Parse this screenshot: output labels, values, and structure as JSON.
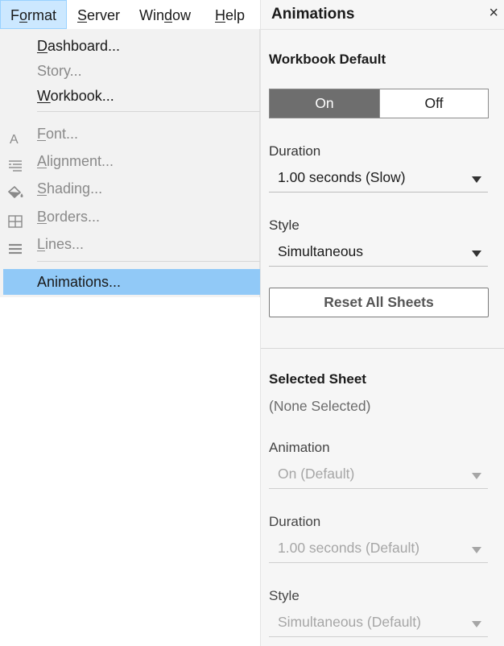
{
  "menubar": {
    "items": [
      {
        "pre": "F",
        "u": "o",
        "post": "rmat"
      },
      {
        "pre": "",
        "u": "S",
        "post": "erver"
      },
      {
        "pre": "Win",
        "u": "d",
        "post": "ow"
      },
      {
        "pre": "",
        "u": "H",
        "post": "elp"
      }
    ]
  },
  "format_menu": {
    "dashboard": {
      "u": "D",
      "post": "ashboard..."
    },
    "story": {
      "label": "Story..."
    },
    "workbook": {
      "u": "W",
      "post": "orkbook..."
    },
    "font": {
      "u": "F",
      "post": "ont...",
      "icon": "font-icon"
    },
    "alignment": {
      "u": "A",
      "post": "lignment...",
      "icon": "alignment-icon"
    },
    "shading": {
      "u": "S",
      "post": "hading...",
      "icon": "paint-bucket-icon"
    },
    "borders": {
      "u": "B",
      "post": "orders...",
      "icon": "borders-icon"
    },
    "lines": {
      "u": "L",
      "post": "ines...",
      "icon": "lines-icon"
    },
    "animations": {
      "label": "Animations..."
    }
  },
  "panel": {
    "title": "Animations",
    "close_glyph": "×",
    "workbook_default": {
      "title": "Workbook Default",
      "toggle": {
        "on": "On",
        "off": "Off",
        "selected": "On"
      },
      "duration_label": "Duration",
      "duration_value": "1.00 seconds (Slow)",
      "style_label": "Style",
      "style_value": "Simultaneous",
      "reset_label": "Reset All Sheets"
    },
    "selected_sheet": {
      "title": "Selected Sheet",
      "none_selected": "(None Selected)",
      "animation_label": "Animation",
      "animation_value": "On (Default)",
      "duration_label": "Duration",
      "duration_value": "1.00 seconds (Default)",
      "style_label": "Style",
      "style_value": "Simultaneous (Default)"
    }
  },
  "colors": {
    "menu_highlight": "#91c9f7",
    "active_menu_bg": "#cce8ff",
    "toggle_on_bg": "#6e6e6e"
  }
}
